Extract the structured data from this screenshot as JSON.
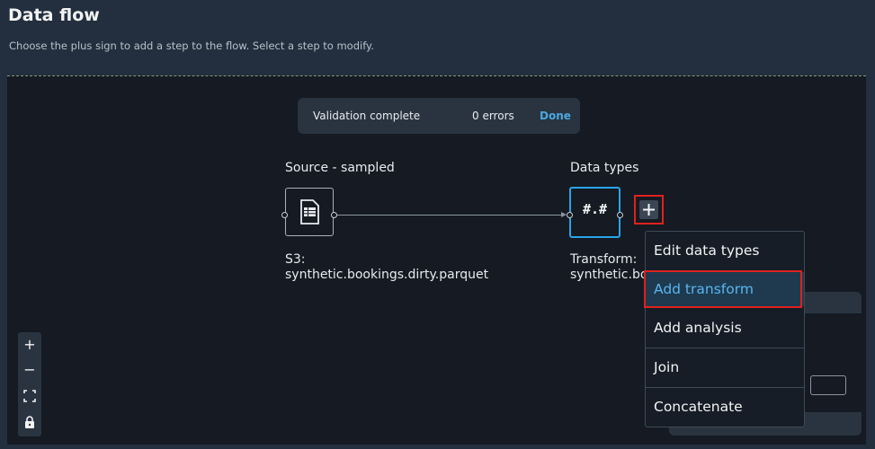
{
  "header": {
    "title": "Data flow",
    "subtitle": "Choose the plus sign to add a step to the flow. Select a step to modify."
  },
  "banner": {
    "title": "Validation complete",
    "errors": "0 errors",
    "done_label": "Done"
  },
  "nodes": [
    {
      "label": "Source - sampled",
      "desc_line1": "S3:",
      "desc_line2": "synthetic.bookings.dirty.parquet",
      "icon": "table-file-icon"
    },
    {
      "label": "Data types",
      "symbol": "#.#",
      "desc_line1": "Transform:",
      "desc_line2": "synthetic.bo",
      "icon": "data-types-icon"
    }
  ],
  "add_step_button": {
    "icon": "plus-icon"
  },
  "menu": {
    "items": [
      {
        "label": "Edit data types"
      },
      {
        "label": "Add transform"
      },
      {
        "label": "Add analysis"
      },
      {
        "label": "Join"
      },
      {
        "label": "Concatenate"
      }
    ],
    "highlighted": "Add transform"
  },
  "zoom_controls": [
    {
      "icon": "zoom-in-icon",
      "glyph": "+"
    },
    {
      "icon": "zoom-out-icon",
      "glyph": "−"
    },
    {
      "icon": "fit-view-icon",
      "glyph": "⛶"
    },
    {
      "icon": "lock-icon",
      "glyph": "🔒"
    }
  ],
  "colors": {
    "accent": "#2aa4e8",
    "highlight_border": "#e0211d",
    "link": "#4aa8e0"
  }
}
